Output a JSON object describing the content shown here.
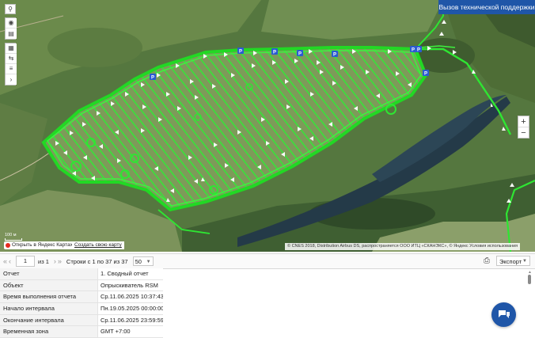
{
  "header": {
    "support_label": "Вызов технической поддержки"
  },
  "map": {
    "scale_label": "100 м",
    "open_in_yandex": "Открыть в Яндекс Картах",
    "create_map": "Создать свою карту",
    "copyright": "© CNES 2018, Distribution Airbus DS, распространяется ООО ИТЦ «СКАНЭКС», © Яндекс  Условия использования",
    "parking_label": "P",
    "zoom_in": "+",
    "zoom_out": "−",
    "icons": [
      "search-icon",
      "eye-icon",
      "map-book-icon",
      "calendar-icon",
      "route-icon",
      "segments-icon",
      "expand-icon"
    ],
    "colors": {
      "track": "#32e632",
      "track_dark": "#18c21e",
      "parking": "#2a5bd1",
      "water": "#263e4e"
    }
  },
  "pager": {
    "first": "«",
    "prev": "‹",
    "page": "1",
    "of_label": "из 1",
    "next": "›",
    "last": "»",
    "rows_label": "Строки с 1 по 37 из 37",
    "page_size": "50",
    "export_label": "Экспорт"
  },
  "report": {
    "rows": [
      {
        "label": "Отчет",
        "value": "1. Сводный отчет"
      },
      {
        "label": "Объект",
        "value": "Опрыскиватель RSM"
      },
      {
        "label": "Время выполнения отчета",
        "value": "Ср.11.06.2025 10:37:43"
      },
      {
        "label": "Начало интервала",
        "value": "Пн.19.05.2025 00:00:00"
      },
      {
        "label": "Окончание интервала",
        "value": "Ср.11.06.2025 23:59:59"
      },
      {
        "label": "Временная зона",
        "value": "GMT +7:00"
      }
    ]
  }
}
